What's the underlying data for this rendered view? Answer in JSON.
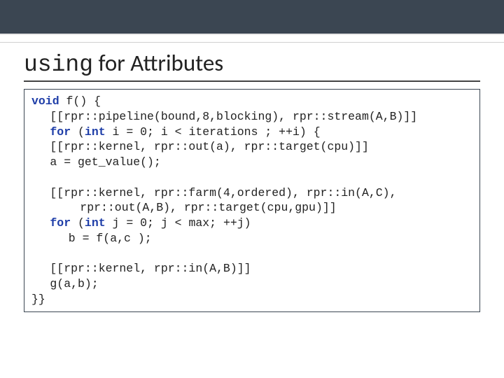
{
  "title": {
    "keyword": "using",
    "rest": "for Attributes"
  },
  "code": {
    "l1a": "void",
    "l1b": " f() {",
    "l2": "[[rpr::pipeline(bound,8,blocking), rpr::stream(A,B)]]",
    "l3a": "for",
    "l3b": " (",
    "l3c": "int",
    "l3d": " i = 0; i < iterations ; ++i) {",
    "l4": "[[rpr::kernel, rpr::out(a), rpr::target(cpu)]]",
    "l5": "a = get_value();",
    "l6": "[[rpr::kernel, rpr::farm(4,ordered), rpr::in(A,C),",
    "l7": "rpr::out(A,B), rpr::target(cpu,gpu)]]",
    "l8a": "for",
    "l8b": " (",
    "l8c": "int",
    "l8d": " j = 0; j < max; ++j)",
    "l9": "b = f(a,c );",
    "l10": "[[rpr::kernel, rpr::in(A,B)]]",
    "l11": "g(a,b);",
    "l12": "}}"
  }
}
